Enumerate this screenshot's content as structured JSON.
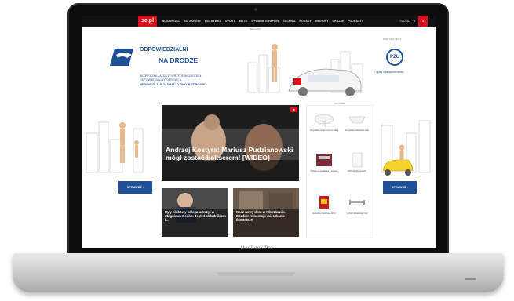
{
  "laptop": {
    "brand": "MacBook Pro"
  },
  "nav": {
    "logo": "se.pl",
    "items": [
      "WIADOMOŚCI",
      "NA SKRÓTY",
      "ROZRYWKA",
      "SPORT",
      "MOTO",
      "WYDANIE E-PAPIER",
      "KUCHNIA",
      "PORADY",
      "REGIONY",
      "OKAZJE",
      "PODCASTY"
    ],
    "right": "SZUKAJ"
  },
  "banner": {
    "ad_tag": "REKLAMA",
    "title_line1": "ODPOWIEDZIALNI",
    "title_line2": "NA DRODZE",
    "subtitle": "BEZPIECZNA JAZDA TO PRZEDE WSZYSTKIM ODPOWIEDZIALNY KIEROWCA.",
    "cta": "SPRAWDŹ, JAK ZADBAĆ O SWOJE ZDROWIE ›",
    "partner_label": "PARTNER AKCJI",
    "partner_logo": "PZU",
    "partner_sub": "Z myślą o bezpieczeństwie"
  },
  "main_article": {
    "title": "Andrzej Kostyra: Mariusz Pudzianowski mógł zostać bokserem! [WIDEO]",
    "video_badge": "▶"
  },
  "small_articles": [
    {
      "title": "Były klubowy kolega uderzył w Zbigniewa Bońka: Jesteś obłudnikiem i..."
    },
    {
      "title": "Nasz nowy dom w Pilarzkowie. Dowbor remontuje mieszkanie listonosze"
    }
  ],
  "widget": {
    "tag": "REKLAMA",
    "products": [
      {
        "label": "Umywalka ceramiczna Cersanit"
      },
      {
        "label": "Umywalka nablatowa Koło"
      },
      {
        "label": "Szafka umywalkowa z lustrem"
      },
      {
        "label": "Zbiornik WC Geberit"
      },
      {
        "label": "Gaśnica proszkowa GP-2"
      },
      {
        "label": "Uchwyt łazienkowy stal"
      }
    ]
  },
  "side_buttons": {
    "left": "SPRAWDŹ ›",
    "right": "SPRAWDŹ ›"
  },
  "colors": {
    "accent": "#1e4f99",
    "brand_red": "#d8121a"
  }
}
